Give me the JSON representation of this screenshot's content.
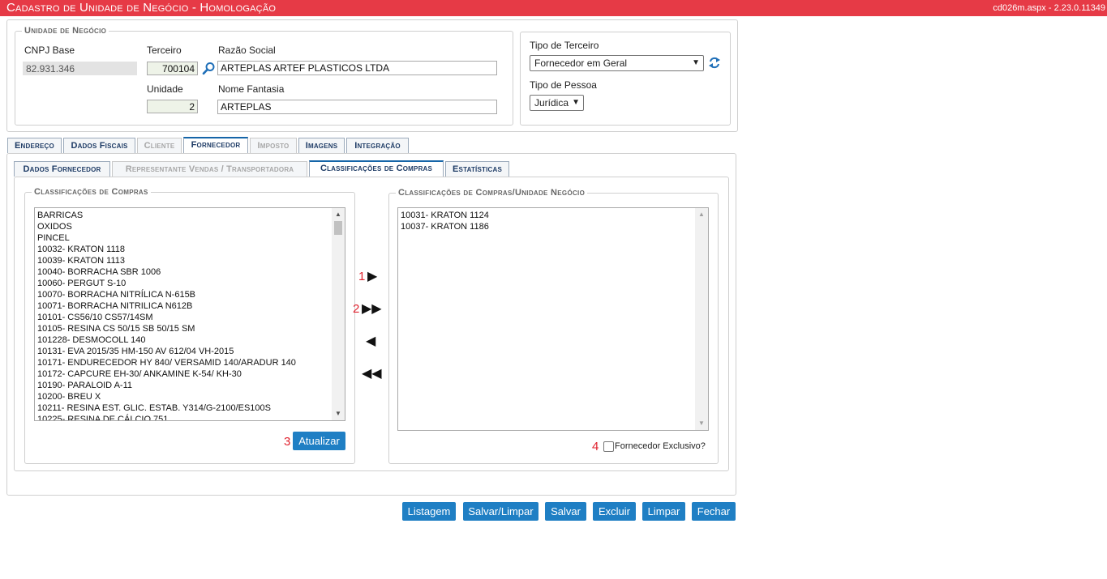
{
  "header": {
    "title": "Cadastro de Unidade de Negócio  - Homologação",
    "version": "cd026m.aspx - 2.23.0.11349"
  },
  "unidade": {
    "legend": "Unidade de Negócio",
    "cnpj_label": "CNPJ Base",
    "cnpj_value": "82.931.346",
    "terceiro_label": "Terceiro",
    "terceiro_value": "700104",
    "razao_label": "Razão Social",
    "razao_value": "ARTEPLAS ARTEF PLASTICOS LTDA",
    "unidade_label": "Unidade",
    "unidade_value": "2",
    "fantasia_label": "Nome Fantasia",
    "fantasia_value": "ARTEPLAS"
  },
  "tipo": {
    "terceiro_label": "Tipo de Terceiro",
    "terceiro_value": "Fornecedor em Geral",
    "pessoa_label": "Tipo de Pessoa",
    "pessoa_value": "Jurídica"
  },
  "tabs": [
    {
      "label": "Endereço"
    },
    {
      "label": "Dados Fiscais"
    },
    {
      "label": "Cliente"
    },
    {
      "label": "Fornecedor"
    },
    {
      "label": "Imposto"
    },
    {
      "label": "Imagens"
    },
    {
      "label": "Integração"
    }
  ],
  "subtabs": [
    {
      "label": "Dados Fornecedor"
    },
    {
      "label": "Representante Vendas / Transportadora"
    },
    {
      "label": "Classificações de Compras"
    },
    {
      "label": "Estatísticas"
    }
  ],
  "left_list": {
    "legend": "Classificações de Compras",
    "items": [
      "BARRICAS",
      "OXIDOS",
      "PINCEL",
      "10032- KRATON 1118",
      "10039- KRATON 1113",
      "10040- BORRACHA SBR 1006",
      "10060- PERGUT S-10",
      "10070- BORRACHA NITRÍLICA N-615B",
      "10071- BORRACHA NITRILICA N612B",
      "10101- CS56/10 CS57/14SM",
      "10105- RESINA CS 50/15 SB 50/15 SM",
      "101228- DESMOCOLL 140",
      "10131- EVA 2015/35 HM-150 AV 612/04 VH-2015",
      "10171- ENDURECEDOR HY 840/ VERSAMID 140/ARADUR 140",
      "10172- CAPCURE EH-30/ ANKAMINE K-54/ KH-30",
      "10190- PARALOID A-11",
      "10200- BREU X",
      "10211- RESINA EST. GLIC. ESTAB. Y314/G-2100/ES100S",
      "10225- RESINA DE CÁLCIO 751"
    ],
    "button": "Atualizar"
  },
  "right_list": {
    "legend": "Classificações de Compras/Unidade Negócio",
    "items": [
      "10031- KRATON 1124",
      "10037- KRATON 1186"
    ],
    "checkbox_label": "Fornecedor Exclusivo?"
  },
  "annotations": [
    "1",
    "2",
    "3",
    "4"
  ],
  "footer_buttons": [
    "Listagem",
    "Salvar/Limpar",
    "Salvar",
    "Excluir",
    "Limpar",
    "Fechar"
  ]
}
